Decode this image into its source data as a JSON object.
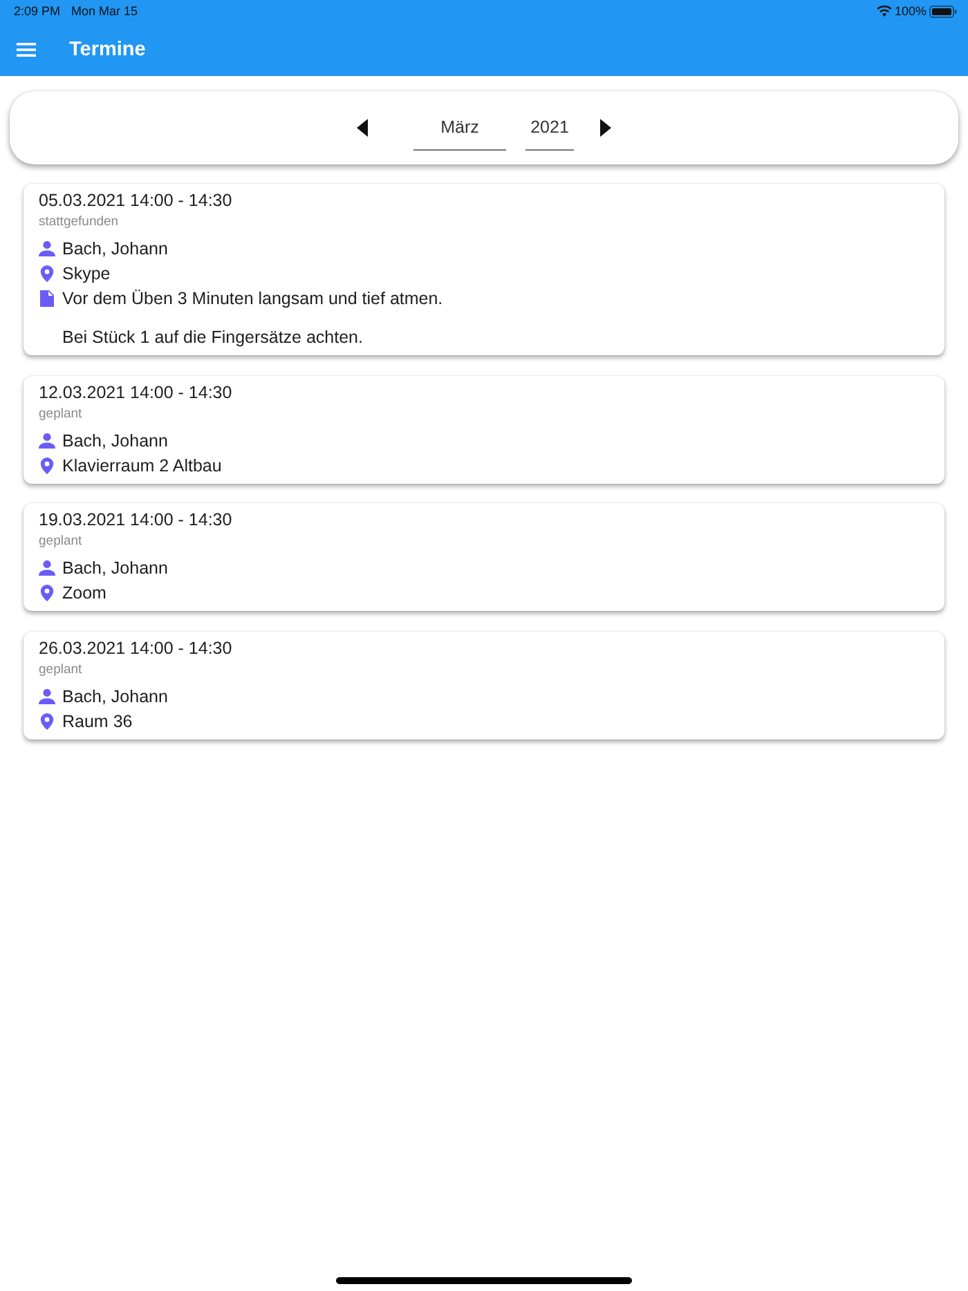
{
  "status_bar": {
    "time": "2:09 PM",
    "date": "Mon Mar 15",
    "battery": "100%"
  },
  "app_bar": {
    "title": "Termine"
  },
  "month_picker": {
    "month": "März",
    "year": "2021"
  },
  "appointments": [
    {
      "datetime": "05.03.2021 14:00 - 14:30",
      "status": "stattgefunden",
      "person": "Bach, Johann",
      "location": "Skype",
      "note": [
        "Vor dem Üben 3 Minuten langsam und tief atmen.",
        "Bei Stück 1 auf die Fingersätze achten."
      ]
    },
    {
      "datetime": "12.03.2021 14:00 - 14:30",
      "status": "geplant",
      "person": "Bach, Johann",
      "location": "Klavierraum 2 Altbau"
    },
    {
      "datetime": "19.03.2021 14:00 - 14:30",
      "status": "geplant",
      "person": "Bach, Johann",
      "location": "Zoom"
    },
    {
      "datetime": "26.03.2021 14:00 - 14:30",
      "status": "geplant",
      "person": "Bach, Johann",
      "location": "Raum 36"
    }
  ]
}
